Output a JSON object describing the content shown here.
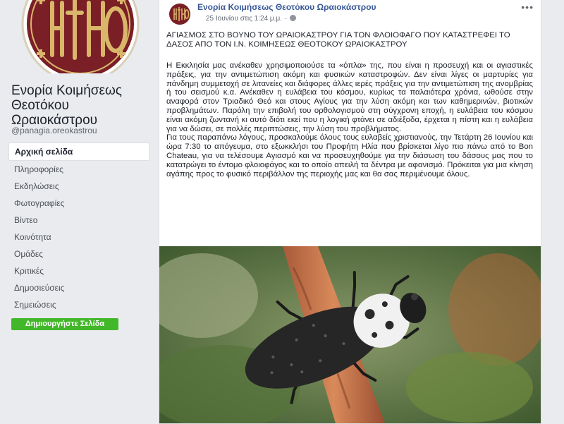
{
  "page": {
    "name_lines": [
      "Ενορία Κοιμήσεως",
      "Θεοτόκου",
      "Ωραιοκάστρου"
    ],
    "handle": "@panagia.oreokastrou"
  },
  "nav": {
    "items": [
      {
        "label": "Αρχική σελίδα",
        "active": true
      },
      {
        "label": "Πληροφορίες"
      },
      {
        "label": "Εκδηλώσεις"
      },
      {
        "label": "Φωτογραφίες"
      },
      {
        "label": "Βίντεο"
      },
      {
        "label": "Κοινότητα"
      },
      {
        "label": "Ομάδες"
      },
      {
        "label": "Κριτικές"
      },
      {
        "label": "Δημοσιεύσεις"
      },
      {
        "label": "Σημειώσεις"
      }
    ],
    "create_page_label": "Δημιουργήστε Σελίδα"
  },
  "post": {
    "author": "Ενορία Κοιμήσεως Θεοτόκου Ωραιοκάστρου",
    "timestamp": "25 Ιουνίου στις 1:24 μ.μ. ·",
    "more_label": "•••",
    "title": "ΑΓΙΑΣΜΟΣ ΣΤΟ ΒΟΥΝΟ ΤΟΥ ΩΡΑΙΟΚΑΣΤΡΟΥ ΓΙΑ ΤΟΝ ΦΛΟΙΟΦΑΓΟ ΠΟΥ ΚΑΤΑΣΤΡΕΦΕΙ ΤΟ ΔΑΣΟΣ ΑΠΟ ΤΟΝ Ι.Ν. ΚΟΙΜΗΣΕΩΣ ΘΕΟΤΟΚΟΥ ΩΡΑΙΟΚΑΣΤΡΟΥ",
    "paragraph1": "Η Εκκλησία μας ανέκαθεν χρησιμοποιούσε τα «όπλα» της, που είναι η προσευχή και οι αγιαστικές πράξεις, για την αντιμετώπιση ακόμη και φυσικών καταστροφών. Δεν είναι λίγες οι μαρτυρίες για πάνδημη συμμετοχή σε λιτανείες και διάφορες άλλες ιερές πράξεις για την αντιμετώπιση της ανομβρίας ή του σεισμού κ.α. Ανέκαθεν η ευλάβεια του κόσμου, κυρίως τα παλαιότερα χρόνια, ωθούσε στην αναφορά στον Τριαδικό Θεό και στους Αγίους για την λύση ακόμη και των καθημερινών, βιοτικών προβλημάτων. Παρόλη την επιβολή του ορθολογισμού στη σύγχρονη εποχή, η ευλάβεια του κόσμου είναι ακόμη ζωντανή κι αυτό διότι εκεί που η λογική φτάνει σε αδιέξοδα, έρχεται η πίστη και η ευλάβεια για να δώσει, σε πολλές περιπτώσεις, την λύση του προβλήματος.",
    "paragraph2": "Για τους παραπάνω λόγους, προσκαλούμε όλους τους ευλαβείς χριστιανούς, την Τετάρτη 26 Ιουνίου και ώρα 7:30 το απόγευμα, στο εξωκκλήσι του Προφήτη Ηλία που βρίσκεται λίγο πιο πάνω από το Bon Chateau, για να τελέσουμε Αγιασμό και να προσευχηθούμε για την διάσωση του δάσους μας που το κατατρώγει το έντομο φλοιοφάγος και το οποίο απειλή τα δέντρα με αφανισμό. Πρόκειται για μια κίνηση αγάπης προς το φυσικό περιβάλλον της περιοχής μας και θα σας περιμένουμε όλους."
  },
  "colors": {
    "background": "#e9ebee",
    "link": "#385898",
    "create_button": "#42b72a",
    "logo_red": "#7a1f26",
    "logo_gold": "#d9b66a"
  },
  "icons": [
    "church-logo-icon",
    "globe-icon",
    "more-options-icon"
  ]
}
